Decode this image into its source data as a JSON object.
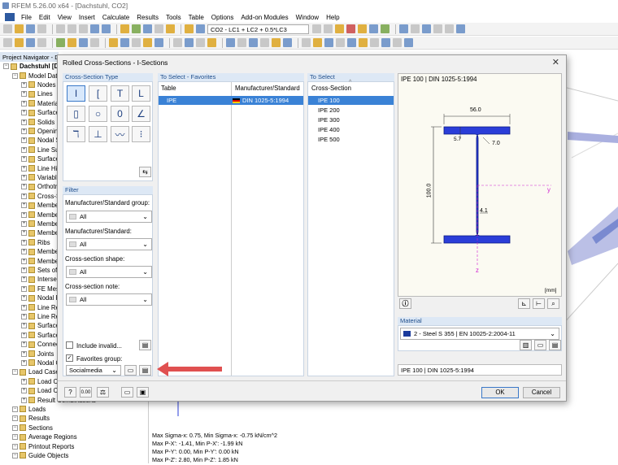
{
  "app": {
    "title": "RFEM 5.26.00 x64 - [Dachstuhl, CO2]"
  },
  "menu": [
    "File",
    "Edit",
    "View",
    "Insert",
    "Calculate",
    "Results",
    "Tools",
    "Table",
    "Options",
    "Add-on Modules",
    "Window",
    "Help"
  ],
  "toolbar": {
    "load_combo": "CO2 - LC1 + LC2 + 0.5*LC3"
  },
  "navigator": {
    "title": "Project Navigator - Data",
    "items": [
      {
        "label": "Dachstuhl [Dachstuhl]",
        "level": 0,
        "bold": true
      },
      {
        "label": "Model Data",
        "level": 1
      },
      {
        "label": "Nodes",
        "level": 2
      },
      {
        "label": "Lines",
        "level": 2
      },
      {
        "label": "Materials",
        "level": 2
      },
      {
        "label": "Surfaces",
        "level": 2
      },
      {
        "label": "Solids",
        "level": 2
      },
      {
        "label": "Openings",
        "level": 2
      },
      {
        "label": "Nodal Supports",
        "level": 2
      },
      {
        "label": "Line Supports",
        "level": 2
      },
      {
        "label": "Surface Supports",
        "level": 2
      },
      {
        "label": "Line Hinges",
        "level": 2
      },
      {
        "label": "Variable Thicknesses",
        "level": 2
      },
      {
        "label": "Orthotropic Surfaces",
        "level": 2
      },
      {
        "label": "Cross-Sections",
        "level": 2
      },
      {
        "label": "Member Hinges",
        "level": 2
      },
      {
        "label": "Member Eccentricities",
        "level": 2
      },
      {
        "label": "Member Divisions",
        "level": 2
      },
      {
        "label": "Members",
        "level": 2
      },
      {
        "label": "Ribs",
        "level": 2
      },
      {
        "label": "Member Elastic Foundations",
        "level": 2
      },
      {
        "label": "Member Nonlinearities",
        "level": 2
      },
      {
        "label": "Sets of Members",
        "level": 2
      },
      {
        "label": "Intersections",
        "level": 2
      },
      {
        "label": "FE Mesh Refinements",
        "level": 2
      },
      {
        "label": "Nodal Releases",
        "level": 2
      },
      {
        "label": "Line Release Types",
        "level": 2
      },
      {
        "label": "Line Releases",
        "level": 2
      },
      {
        "label": "Surface Release Types",
        "level": 2
      },
      {
        "label": "Surface Releases",
        "level": 2
      },
      {
        "label": "Connection of Two Members",
        "level": 2
      },
      {
        "label": "Joints",
        "level": 2
      },
      {
        "label": "Nodal Constraints",
        "level": 2
      },
      {
        "label": "Load Cases and Combinations",
        "level": 1
      },
      {
        "label": "Load Cases",
        "level": 2
      },
      {
        "label": "Load Combinations",
        "level": 2
      },
      {
        "label": "Result Combinations",
        "level": 2
      },
      {
        "label": "Loads",
        "level": 1
      },
      {
        "label": "Results",
        "level": 1
      },
      {
        "label": "Sections",
        "level": 1
      },
      {
        "label": "Average Regions",
        "level": 1
      },
      {
        "label": "Printout Reports",
        "level": 1
      },
      {
        "label": "Guide Objects",
        "level": 1
      }
    ]
  },
  "status": [
    "Max Sigma-x: 0.75, Min Sigma-x: -0.75 kN/cm^2",
    "Max P-X': -1.41, Min P-X': -1.99 kN",
    "Max P-Y': 0.00, Min P-Y': 0.00 kN",
    "Max P-Z': 2.80, Min P-Z': 1.85 kN"
  ],
  "dialog": {
    "title": "Rolled Cross-Sections - I-Sections",
    "cs_type_header": "Cross-Section Type",
    "filter": {
      "header": "Filter",
      "mfr_group_label": "Manufacturer/Standard group:",
      "mfr_group_value": "All",
      "mfr_label": "Manufacturer/Standard:",
      "mfr_value": "All",
      "shape_label": "Cross-section shape:",
      "shape_value": "All",
      "note_label": "Cross-section note:",
      "note_value": "All",
      "include_invalid": "Include invalid...",
      "favorites_group": "Favorites group:",
      "favorites_value": "Socialmedia"
    },
    "favorites": {
      "header": "To Select - Favorites",
      "col_table": "Table",
      "col_mfr": "Manufacturer/Standard",
      "row_table": "IPE",
      "row_mfr": "DIN 1025-5:1994"
    },
    "to_select": {
      "header": "To Select",
      "col": "Cross-Section",
      "items": [
        "IPE 100",
        "IPE 200",
        "IPE 300",
        "IPE 400",
        "IPE 500"
      ],
      "selected_index": 0
    },
    "preview": {
      "title": "IPE 100 | DIN 1025-5:1994",
      "dim_width": "56.0",
      "dim_flange": "5.7",
      "dim_radius": "7.0",
      "dim_height": "100.0",
      "dim_web": "4.1",
      "axis_y": "y",
      "axis_z": "z",
      "units": "[mm]"
    },
    "material": {
      "header": "Material",
      "value": "2 - Steel S 355 | EN 10025-2:2004-11",
      "color": "#1a3a9c"
    },
    "summary": "IPE 100 | DIN 1025-5:1994",
    "ok": "OK",
    "cancel": "Cancel"
  },
  "colors": {
    "selection": "#3a82d6",
    "profile_fill": "#2a3dd8",
    "group_header": "#dde8f5",
    "arrow": "#e05050"
  }
}
